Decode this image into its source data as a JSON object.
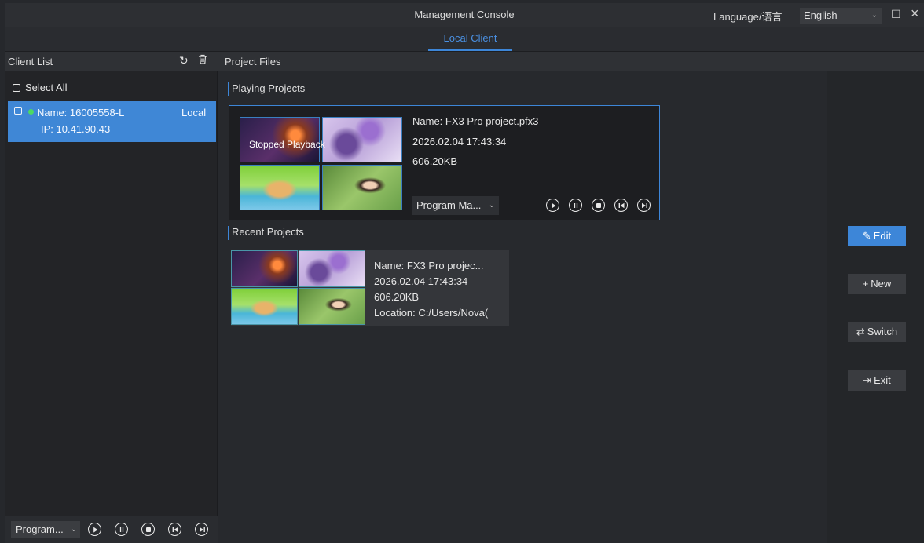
{
  "window": {
    "title": "Management Console",
    "language_label": "Language/语言",
    "language_value": "English",
    "maximize_icon": "maximize-icon",
    "close_icon": "close-icon"
  },
  "tabs": [
    {
      "label": "Local Client",
      "active": true
    }
  ],
  "client_list": {
    "title": "Client List",
    "select_all": "Select All",
    "clients": [
      {
        "name": "Name:  16005558-L",
        "ip": "IP: 10.41.90.43",
        "type": "Local",
        "status": "online"
      }
    ],
    "footer_program": "Program...",
    "icons": {
      "refresh": "refresh-icon",
      "delete": "trash-icon"
    }
  },
  "project_files": {
    "title": "Project Files",
    "playing": {
      "section_label": "Playing Projects",
      "overlay_status": "Stopped Playback",
      "name": "Name:  FX3 Pro project.pfx3",
      "date": "2026.02.04 17:43:34",
      "size": "606.20KB",
      "program": "Program Ma..."
    },
    "recent": {
      "section_label": "Recent Projects",
      "name": "Name:  FX3 Pro projec...",
      "date": "2026.02.04 17:43:34",
      "size": "606.20KB",
      "location": "Location:  C:/Users/Nova("
    }
  },
  "actions": {
    "edit": "Edit",
    "new": "New",
    "switch": "Switch",
    "exit": "Exit"
  },
  "colors": {
    "accent": "#3d86d8",
    "online": "#4cd964",
    "background": "#26282c"
  }
}
